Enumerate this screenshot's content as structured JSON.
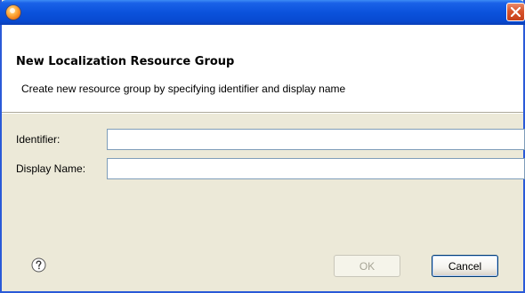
{
  "window": {
    "icon": "app-orb-icon",
    "close_icon": "close-icon",
    "title": ""
  },
  "header": {
    "title": "New Localization Resource Group",
    "description": "Create new resource group by specifying identifier and display name"
  },
  "form": {
    "identifier_label": "Identifier:",
    "identifier_value": "",
    "display_name_label": "Display Name:",
    "display_name_value": ""
  },
  "footer": {
    "help_icon": "help-icon",
    "ok_label": "OK",
    "ok_enabled": false,
    "cancel_label": "Cancel"
  },
  "colors": {
    "titlebar": "#0b52dc",
    "close_button": "#d8542b",
    "dialog_background": "#ece9d8",
    "header_background": "#ffffff"
  }
}
